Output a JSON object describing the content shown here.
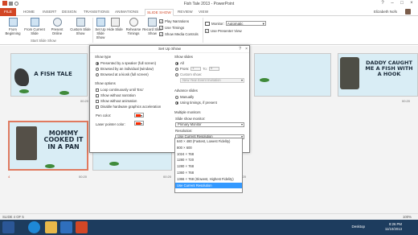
{
  "window": {
    "title": "Fish Tale 2013 - PowerPoint",
    "user": "Elizabeth Nofs"
  },
  "tabs": [
    "FILE",
    "HOME",
    "INSERT",
    "DESIGN",
    "TRANSITIONS",
    "ANIMATIONS",
    "SLIDE SHOW",
    "REVIEW",
    "VIEW"
  ],
  "active_tab": "SLIDE SHOW",
  "ribbon": {
    "from_beginning": "From Beginning",
    "from_current": "From Current Slide",
    "present_online": "Present Online",
    "custom_slide_show": "Custom Slide Show",
    "group_start": "Start Slide Show",
    "set_up": "Set Up Slide Show",
    "hide": "Hide Slide",
    "rehearse": "Rehearse Timings",
    "record": "Record Slide Show",
    "play_narrations": "Play Narrations",
    "use_timings": "Use Timings",
    "show_media_controls": "Show Media Controls",
    "monitor_label": "Monitor:",
    "monitor_value": "Automatic",
    "use_presenter_view": "Use Presenter View"
  },
  "slides": {
    "s1_text": "A FISH TALE",
    "s1_time": "00:20",
    "s3_text": "DADDY CAUGHT ME A FISH WITH A HOOK",
    "s3_time": "00:20",
    "s4_num": "4",
    "s4_text": "MOMMY COOKED IT IN A PAN",
    "s4_time": "00:20",
    "s5_time": "00:20",
    "s6_time": "00:20"
  },
  "status": {
    "slide": "SLIDE 4 OF 5",
    "zoom": "100%"
  },
  "taskbar": {
    "desktop": "Desktop",
    "time": "8:26 PM",
    "date": "11/10/2013"
  },
  "dialog": {
    "title": "Set Up Show",
    "help": "?",
    "close": "×",
    "show_type": "Show type",
    "presented_by_speaker": "Presented by a speaker (full screen)",
    "browsed_individual": "Browsed by an individual (window)",
    "browsed_kiosk": "Browsed at a kiosk (full screen)",
    "show_options": "Show options",
    "loop": "Loop continuously until 'Esc'",
    "without_narration": "Show without narration",
    "without_animation": "Show without animation",
    "disable_hw": "Disable hardware graphics acceleration",
    "pen_color": "Pen color:",
    "laser_color": "Laser pointer color:",
    "show_slides": "Show slides",
    "all": "All",
    "from": "From:",
    "from_value": "1",
    "to": "To:",
    "to_value": "5",
    "custom_show": "Custom show:",
    "custom_show_value": "New Year Event Invitation",
    "advance_slides": "Advance slides",
    "manually": "Manually",
    "using_timings": "Using timings, if present",
    "multiple_monitors": "Multiple monitors",
    "slide_show_monitor": "Slide show monitor:",
    "monitor_value": "Primary Monitor",
    "resolution": "Resolution:",
    "resolution_value": "Use Current Resolution",
    "resolution_options": [
      "640 × 480 (Fastest, Lowest Fidelity)",
      "800 × 600",
      "1024 × 768",
      "1280 × 720",
      "1280 × 768",
      "1360 × 768",
      "1366 × 768 (Slowest, Highest Fidelity)",
      "Use Current Resolution"
    ],
    "selected_index": 7
  },
  "colors": {
    "accent": "#d24726",
    "taskbar": "#1d3c5e",
    "selection": "#3399ff",
    "pen": "#ff2a00"
  }
}
